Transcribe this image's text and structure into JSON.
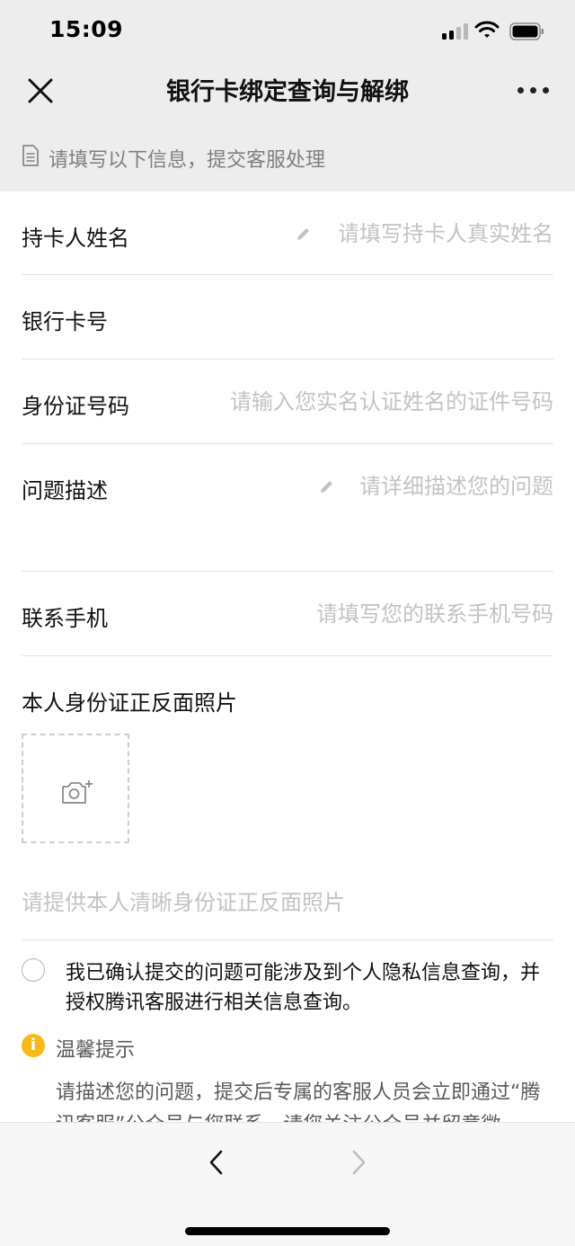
{
  "status_bar": {
    "time": "15:09"
  },
  "nav": {
    "title": "银行卡绑定查询与解绑"
  },
  "hint": {
    "text": "请填写以下信息，提交客服处理"
  },
  "form": {
    "cardholder": {
      "label": "持卡人姓名",
      "placeholder": "请填写持卡人真实姓名",
      "value": ""
    },
    "card_number": {
      "label": "银行卡号",
      "placeholder": "",
      "value": ""
    },
    "id_number": {
      "label": "身份证号码",
      "placeholder": "请输入您实名认证姓名的证件号码",
      "value": ""
    },
    "description": {
      "label": "问题描述",
      "placeholder": "请详细描述您的问题",
      "value": ""
    },
    "phone": {
      "label": "联系手机",
      "placeholder": "请填写您的联系手机号码",
      "value": ""
    }
  },
  "photo": {
    "label": "本人身份证正反面照片",
    "hint": "请提供本人清晰身份证正反面照片"
  },
  "consent": {
    "text": "我已确认提交的问题可能涉及到个人隐私信息查询，并授权腾讯客服进行相关信息查询。",
    "checked": false
  },
  "tip": {
    "icon": "i",
    "title": "温馨提示",
    "body": "请描述您的问题，提交后专属的客服人员会立即通过“腾讯客服”公众号与您联系，请您关注公众号并留意微"
  },
  "colors": {
    "page_bg": "#ededed",
    "tip_yellow": "#f7ba18",
    "placeholder": "#c3c3c3"
  }
}
